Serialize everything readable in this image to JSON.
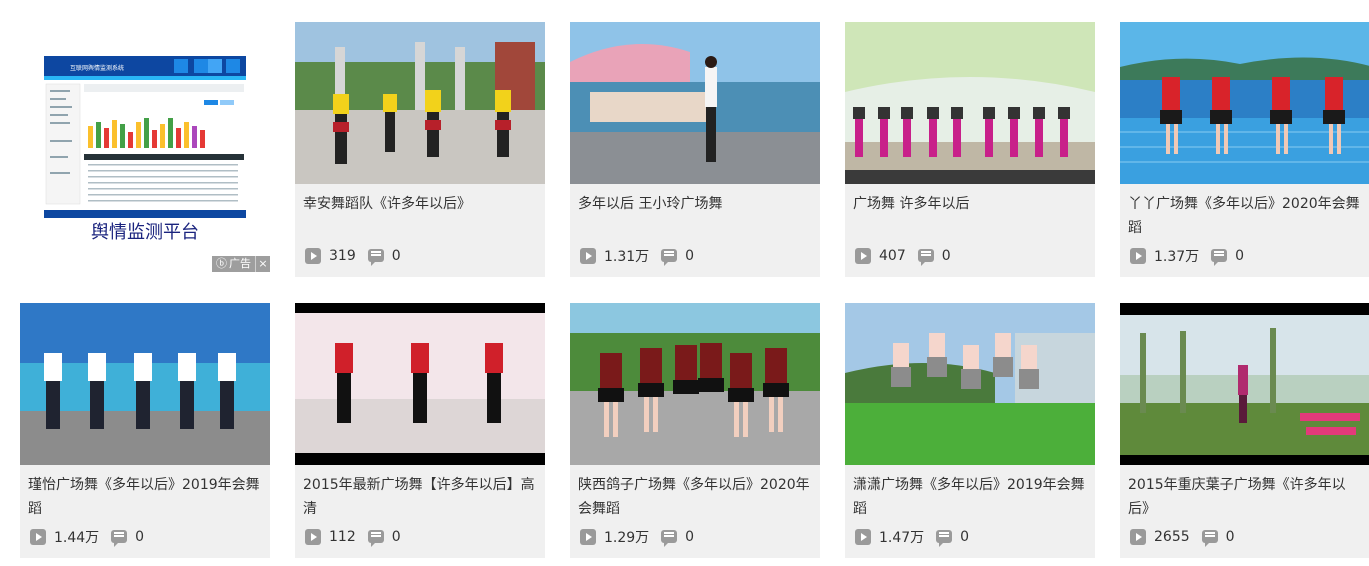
{
  "ad": {
    "caption": "舆情监测平台",
    "badge_label": "广告",
    "close_glyph": "×",
    "screenshot_title": "互联网舆情监测系统"
  },
  "videos": [
    {
      "title": "幸安舞蹈队《许多年以后》",
      "plays": "319",
      "comments": "0"
    },
    {
      "title": "多年以后 王小玲广场舞",
      "plays": "1.31万",
      "comments": "0"
    },
    {
      "title": "广场舞 许多年以后",
      "plays": "407",
      "comments": "0"
    },
    {
      "title": "丫丫广场舞《多年以后》2020年会舞蹈",
      "plays": "1.37万",
      "comments": "0"
    },
    {
      "title": "瑾怡广场舞《多年以后》2019年会舞蹈",
      "plays": "1.44万",
      "comments": "0"
    },
    {
      "title": "2015年最新广场舞【许多年以后】高清",
      "plays": "112",
      "comments": "0"
    },
    {
      "title": "陕西鸽子广场舞《多年以后》2020年会舞蹈",
      "plays": "1.29万",
      "comments": "0"
    },
    {
      "title": "潇潇广场舞《多年以后》2019年会舞蹈",
      "plays": "1.47万",
      "comments": "0"
    },
    {
      "title": "2015年重庆葉子广场舞《许多年以后》",
      "plays": "2655",
      "comments": "0"
    }
  ],
  "icons": {
    "play": "play-icon",
    "comment": "comment-icon",
    "close": "close-icon"
  }
}
